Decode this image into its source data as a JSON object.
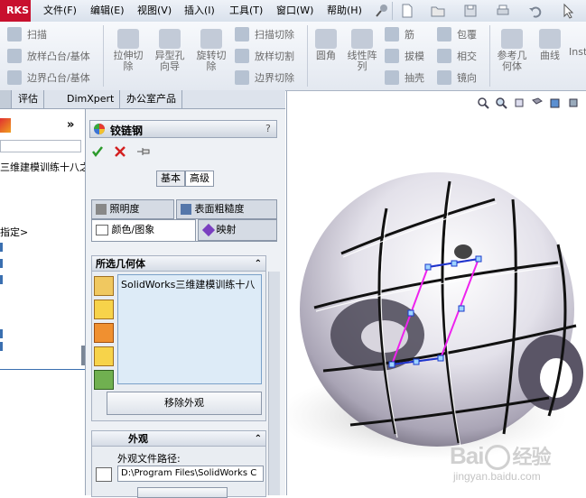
{
  "app": {
    "logo_text": "RKS"
  },
  "menubar": {
    "items": [
      "文件(F)",
      "编辑(E)",
      "视图(V)",
      "插入(I)",
      "工具(T)",
      "窗口(W)",
      "帮助(H)"
    ]
  },
  "ribbon": {
    "left_group": [
      "扫描",
      "放样凸台/基体",
      "边界凸台/基体"
    ],
    "big_buttons": [
      {
        "line1": "拉伸切",
        "line2": "除"
      },
      {
        "line1": "异型孔",
        "line2": "向导"
      },
      {
        "line1": "旋转切",
        "line2": "除"
      }
    ],
    "cut_group": [
      "扫描切除",
      "放样切割",
      "边界切除"
    ],
    "fillet": "圆角",
    "linear_pattern": {
      "line1": "线性阵",
      "line2": "列"
    },
    "feature_col1": [
      "筋",
      "拔模",
      "抽壳"
    ],
    "feature_col2": [
      "包覆",
      "相交",
      "镜向"
    ],
    "ref_geom": {
      "line1": "参考几",
      "line2": "何体"
    },
    "curves": "曲线",
    "instant3d": "Inst"
  },
  "tabs": [
    "评估",
    "DimXpert",
    "办公室产品"
  ],
  "tree": {
    "items": [
      "三维建模训练十八之",
      "指定>"
    ]
  },
  "property_manager": {
    "title": "铰链钢",
    "help": "?",
    "mode_tabs": [
      "基本",
      "高级"
    ],
    "subtabs_row1": [
      "照明度",
      "表面粗糙度"
    ],
    "subtabs_row2": [
      "颜色/图象",
      "映射"
    ],
    "selected_geometry": {
      "header": "所选几何体",
      "entry": "SolidWorks三维建模训练十八",
      "remove_button": "移除外观"
    },
    "appearance": {
      "header": "外观",
      "path_label": "外观文件路径:",
      "path_value": "D:\\Program Files\\SolidWorks C"
    }
  },
  "watermark": {
    "brand": "Bai",
    "brand2": "经验",
    "url": "jingyan.baidu.com"
  }
}
